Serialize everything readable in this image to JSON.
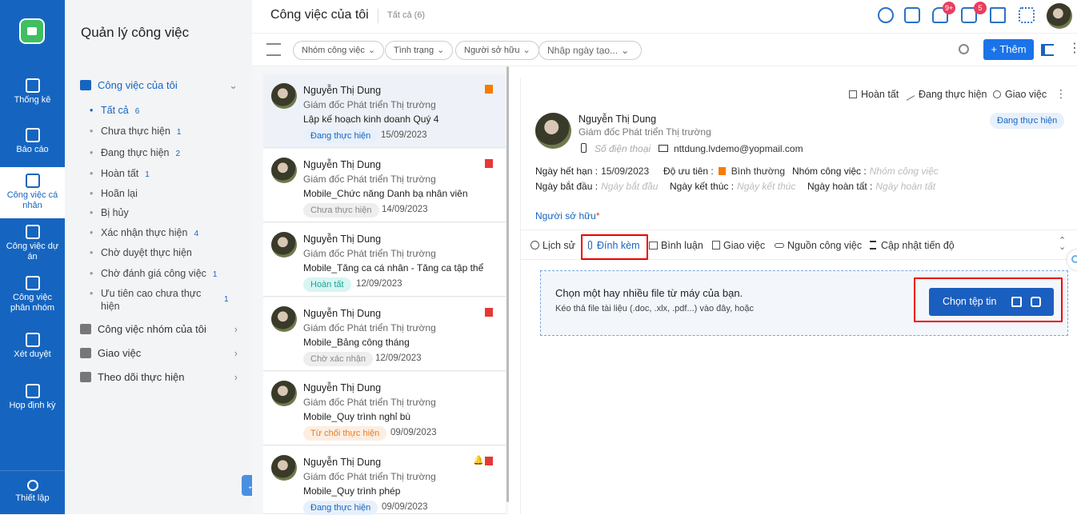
{
  "rail": {
    "items": [
      {
        "label": "Thống kê",
        "icon": "bar-chart-icon"
      },
      {
        "label": "Báo cáo",
        "icon": "report-icon"
      },
      {
        "label": "Công việc cá nhân",
        "icon": "personal-task-icon"
      },
      {
        "label": "Công việc dự án",
        "icon": "project-task-icon"
      },
      {
        "label": "Công việc phân nhóm",
        "icon": "group-task-icon"
      },
      {
        "label": "Xét duyệt",
        "icon": "approval-icon"
      },
      {
        "label": "Họp định kỳ",
        "icon": "calendar-icon"
      },
      {
        "label": "Thiết lập",
        "icon": "gear-icon"
      }
    ]
  },
  "sidebar": {
    "title": "Quản lý công việc",
    "groups": [
      {
        "label": "Công việc của tôi",
        "expanded": true
      },
      {
        "label": "Công việc nhóm của tôi"
      },
      {
        "label": "Giao việc"
      },
      {
        "label": "Theo dõi thực hiện"
      }
    ],
    "subitems": [
      {
        "label": "Tất cả",
        "count": "6"
      },
      {
        "label": "Chưa thực hiện",
        "count": "1"
      },
      {
        "label": "Đang thực hiện",
        "count": "2"
      },
      {
        "label": "Hoàn tất",
        "count": "1"
      },
      {
        "label": "Hoãn lại",
        "count": ""
      },
      {
        "label": "Bị hủy",
        "count": ""
      },
      {
        "label": "Xác nhận thực hiện",
        "count": "4"
      },
      {
        "label": "Chờ duyệt thực hiện",
        "count": ""
      },
      {
        "label": "Chờ đánh giá công việc",
        "count": "1"
      },
      {
        "label": "Ưu tiên cao chưa thực hiện",
        "count": "1"
      }
    ]
  },
  "header": {
    "title": "Công việc của tôi",
    "subtitle": "Tất cả (6)",
    "notif_badge": "9+",
    "task_badge": "5"
  },
  "filters": {
    "chips": [
      "Nhóm công việc",
      "Tình trạng",
      "Người sở hữu",
      "Nhập ngày tạo..."
    ],
    "add_label": "+ Thêm"
  },
  "tasks": [
    {
      "name": "Nguyễn Thị Dung",
      "role": "Giám đốc Phát triển Thị trường",
      "title": "Lập kế hoạch kinh doanh Quý 4",
      "status": "Đang thực hiện",
      "status_color": "#1565c0",
      "status_bg": "#e7f0fb",
      "date": "15/09/2023",
      "flag": "#f57c00"
    },
    {
      "name": "Nguyễn Thị Dung",
      "role": "Giám đốc Phát triển Thị trường",
      "title": "Mobile_Chức năng Danh bạ nhân viên",
      "status": "Chưa thực hiện",
      "status_color": "#888888",
      "status_bg": "#eeeeee",
      "date": "14/09/2023",
      "flag": "#e53935"
    },
    {
      "name": "Nguyễn Thị Dung",
      "role": "Giám đốc Phát triển Thị trường",
      "title": "Mobile_Tăng ca cá nhân - Tăng ca tập thể",
      "status": "Hoàn tất",
      "status_color": "#1aa59a",
      "status_bg": "#d8f5f2",
      "date": "12/09/2023",
      "flag": ""
    },
    {
      "name": "Nguyễn Thị Dung",
      "role": "Giám đốc Phát triển Thị trường",
      "title": "Mobile_Bảng công tháng",
      "status": "Chờ xác nhận",
      "status_color": "#888888",
      "status_bg": "#eeeeee",
      "date": "12/09/2023",
      "flag": "#e53935"
    },
    {
      "name": "Nguyễn Thị Dung",
      "role": "Giám đốc Phát triển Thị trường",
      "title": "Mobile_Quy trình nghỉ bù",
      "status": "Từ chối thực hiện",
      "status_color": "#e67e22",
      "status_bg": "#fdeee2",
      "date": "09/09/2023",
      "flag": ""
    },
    {
      "name": "Nguyễn Thị Dung",
      "role": "Giám đốc Phát triển Thị trường",
      "title": "Mobile_Quy trình phép",
      "status": "Đang thực hiện",
      "status_color": "#1565c0",
      "status_bg": "#e7f0fb",
      "date": "09/09/2023",
      "flag": "#e53935",
      "bell": "🔔"
    }
  ],
  "detail": {
    "actions": [
      "Hoàn tất",
      "Đang thực hiện",
      "Giao việc"
    ],
    "name": "Nguyễn Thị Dung",
    "role": "Giám đốc Phát triển Thị trường",
    "phone_placeholder": "Số điện thoại",
    "email": "nttdung.lvdemo@yopmail.com",
    "status": "Đang thực hiện",
    "fields": {
      "deadline_label": "Ngày hết hạn :",
      "deadline": "15/09/2023",
      "priority_label": "Độ ưu tiên :",
      "priority": "Bình thường",
      "group_label": "Nhóm công việc :",
      "group_ph": "Nhóm công việc",
      "start_label": "Ngày bắt đầu :",
      "start_ph": "Ngày bắt đầu",
      "end_label": "Ngày kết thúc :",
      "end_ph": "Ngày kết thúc",
      "done_label": "Ngày hoàn tất :",
      "done_ph": "Ngày hoàn tất"
    },
    "owner_label": "Người sở hữu",
    "owner_required": "*",
    "tabs": [
      "Lịch sử",
      "Đính kèm",
      "Bình luận",
      "Giao việc",
      "Nguồn công việc",
      "Cập nhật tiến độ"
    ],
    "active_tab": "Đính kèm",
    "upload": {
      "title": "Chọn một hay nhiều file từ máy của bạn.",
      "hint": "Kéo thả file tài liệu (.doc, .xlx, .pdf...) vào đây, hoặc",
      "button": "Chọn tệp tin"
    }
  }
}
